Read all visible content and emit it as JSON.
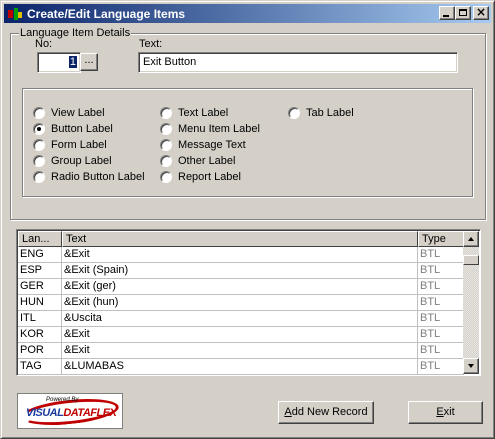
{
  "window": {
    "title": "Create/Edit Language Items"
  },
  "details": {
    "group_title": "Language Item Details",
    "no_label": "No:",
    "no_value": "1",
    "lookup_label": "...",
    "text_label": "Text:",
    "text_value": "Exit Button"
  },
  "radios": [
    {
      "label": "View Label",
      "checked": false
    },
    {
      "label": "Button Label",
      "checked": true
    },
    {
      "label": "Form Label",
      "checked": false
    },
    {
      "label": "Group Label",
      "checked": false
    },
    {
      "label": "Radio Button Label",
      "checked": false
    },
    {
      "label": "Text Label",
      "checked": false
    },
    {
      "label": "Menu Item Label",
      "checked": false
    },
    {
      "label": "Message Text",
      "checked": false
    },
    {
      "label": "Other Label",
      "checked": false
    },
    {
      "label": "Report Label",
      "checked": false
    },
    {
      "label": "Tab Label",
      "checked": false
    }
  ],
  "grid": {
    "columns": [
      "Lan...",
      "Text",
      "Type"
    ],
    "rows": [
      {
        "lang": "ENG",
        "text": "&Exit",
        "type": "BTL"
      },
      {
        "lang": "ESP",
        "text": "&Exit (Spain)",
        "type": "BTL"
      },
      {
        "lang": "GER",
        "text": "&Exit (ger)",
        "type": "BTL"
      },
      {
        "lang": "HUN",
        "text": "&Exit (hun)",
        "type": "BTL"
      },
      {
        "lang": "ITL",
        "text": "&Uscita",
        "type": "BTL"
      },
      {
        "lang": "KOR",
        "text": "&Exit",
        "type": "BTL"
      },
      {
        "lang": "POR",
        "text": "&Exit",
        "type": "BTL"
      },
      {
        "lang": "TAG",
        "text": "&LUMABAS",
        "type": "BTL"
      }
    ]
  },
  "logo": {
    "small_text": "Powered By",
    "brand_a": "VISUAL",
    "brand_b": "DATAFLEX"
  },
  "buttons": {
    "add_new_pre": "A",
    "add_new_rest": "dd New Record",
    "exit_pre": "E",
    "exit_rest": "xit"
  },
  "colors": {
    "titlebar_start": "#0a246a",
    "titlebar_end": "#a6caf0",
    "face": "#d4d0c8"
  }
}
